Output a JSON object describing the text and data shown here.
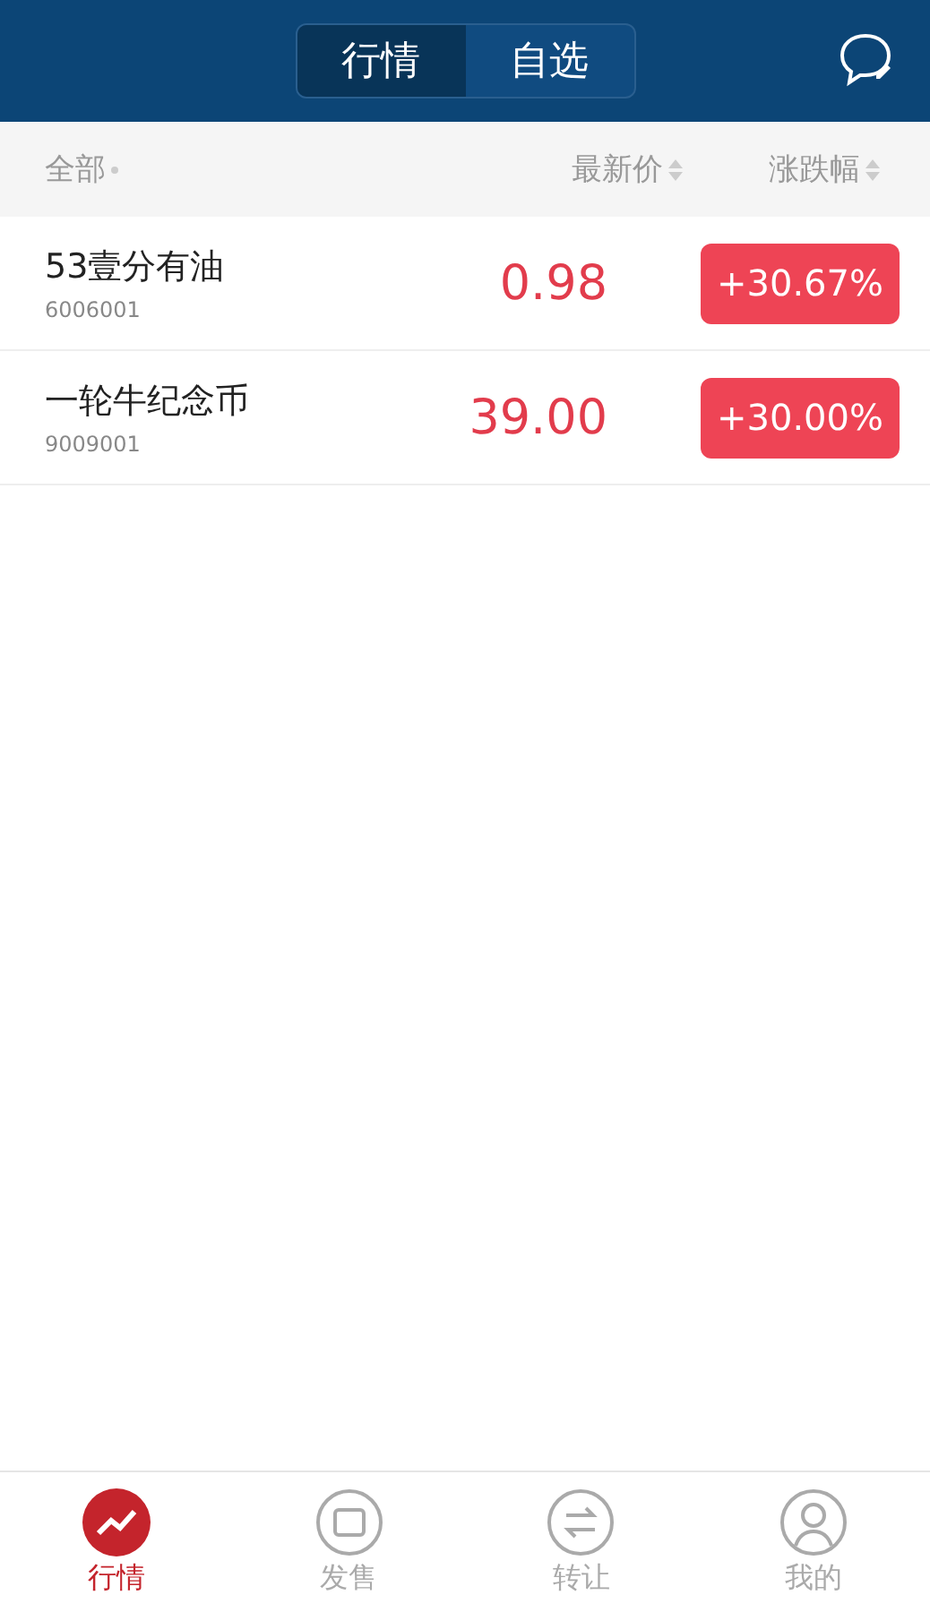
{
  "header": {
    "segments": [
      {
        "label": "行情",
        "selected": true
      },
      {
        "label": "自选",
        "selected": false
      }
    ]
  },
  "table": {
    "columns": [
      "全部",
      "最新价",
      "涨跌幅"
    ],
    "rows": [
      {
        "name": "53壹分有油",
        "code": "6006001",
        "price": "0.98",
        "change": "+30.67%"
      },
      {
        "name": "一轮牛纪念币",
        "code": "9009001",
        "price": "39.00",
        "change": "+30.00%"
      }
    ]
  },
  "tab_bar": [
    {
      "kind": "chart",
      "label": "行情",
      "selected": true
    },
    {
      "kind": "sale",
      "label": "发售",
      "selected": false
    },
    {
      "kind": "transfer",
      "label": "转让",
      "selected": false
    },
    {
      "kind": "user",
      "label": "我的",
      "selected": false
    }
  ]
}
